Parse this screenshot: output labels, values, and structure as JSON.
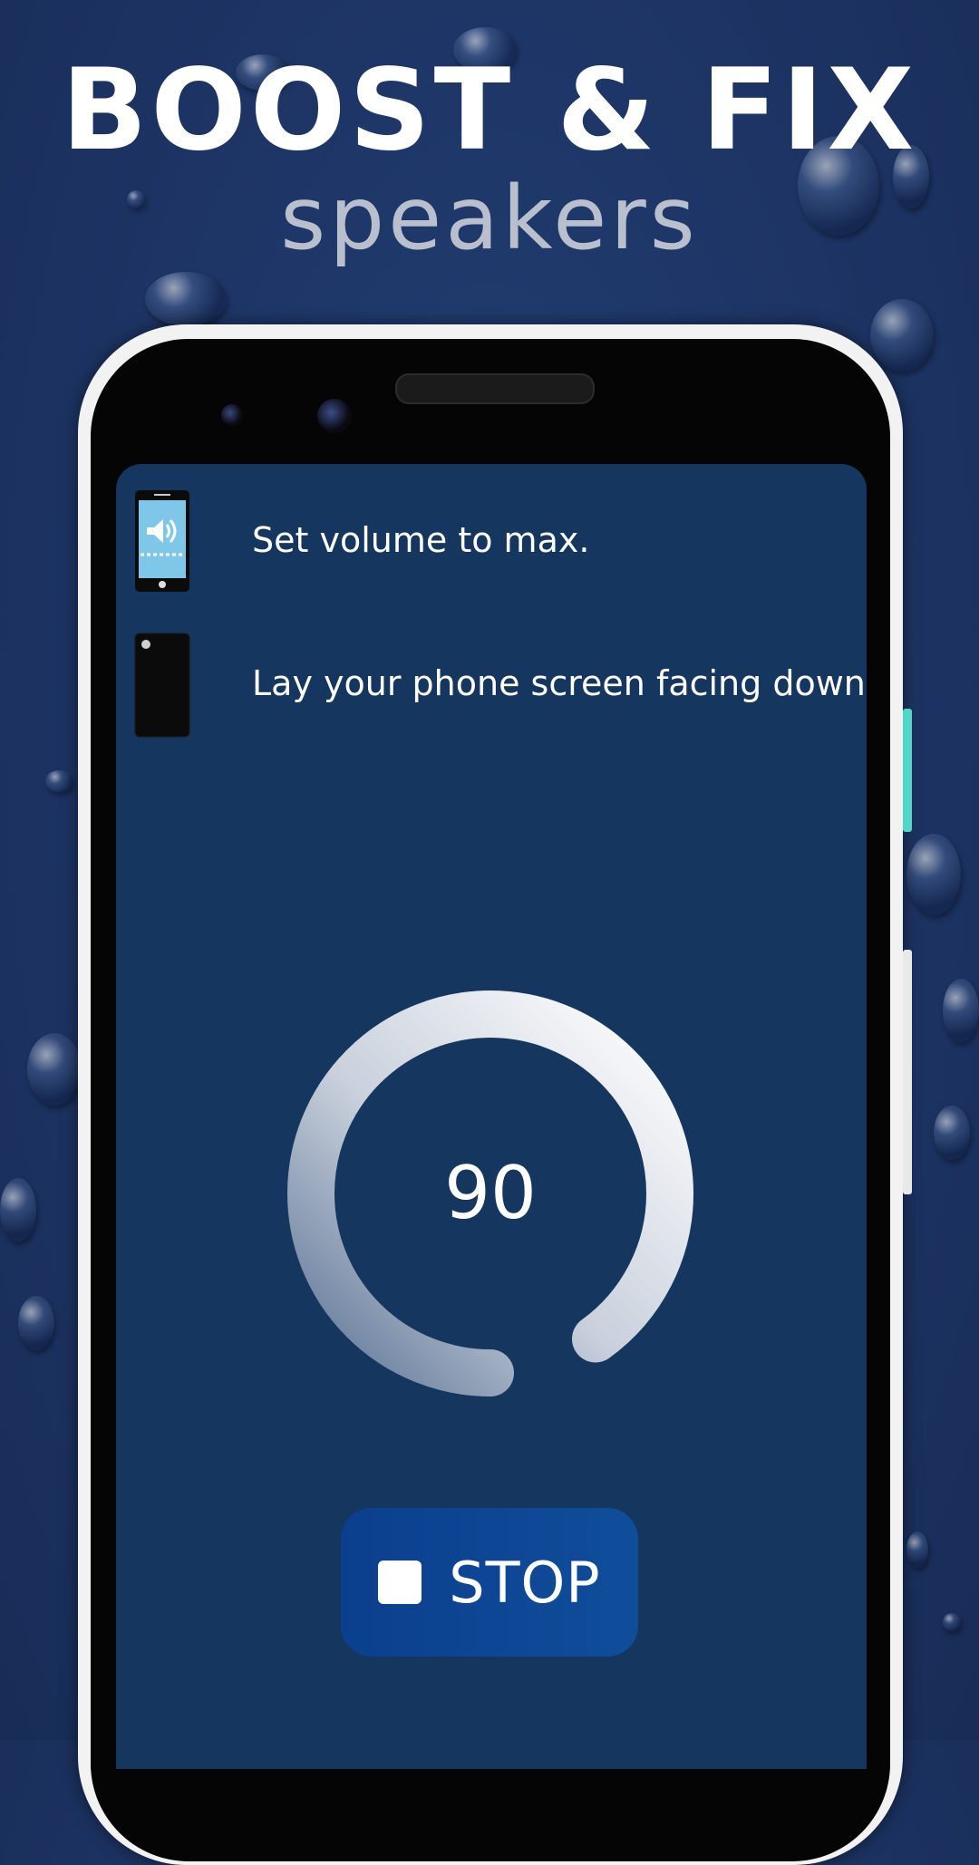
{
  "promo": {
    "headline": "BOOST & FIX",
    "subline": "speakers"
  },
  "steps": [
    {
      "icon": "phone-volume-icon",
      "text": "Set volume to max."
    },
    {
      "icon": "phone-face-down-icon",
      "text": "Lay your phone screen facing down."
    }
  ],
  "progress": {
    "value": "90",
    "fraction": 0.9
  },
  "stop_button": {
    "icon": "stop-icon",
    "label": "STOP"
  },
  "colors": {
    "background": "#1d3464",
    "screen": "#14365f",
    "button": "#0d4593",
    "icon_screen": "#7fc7e8"
  }
}
